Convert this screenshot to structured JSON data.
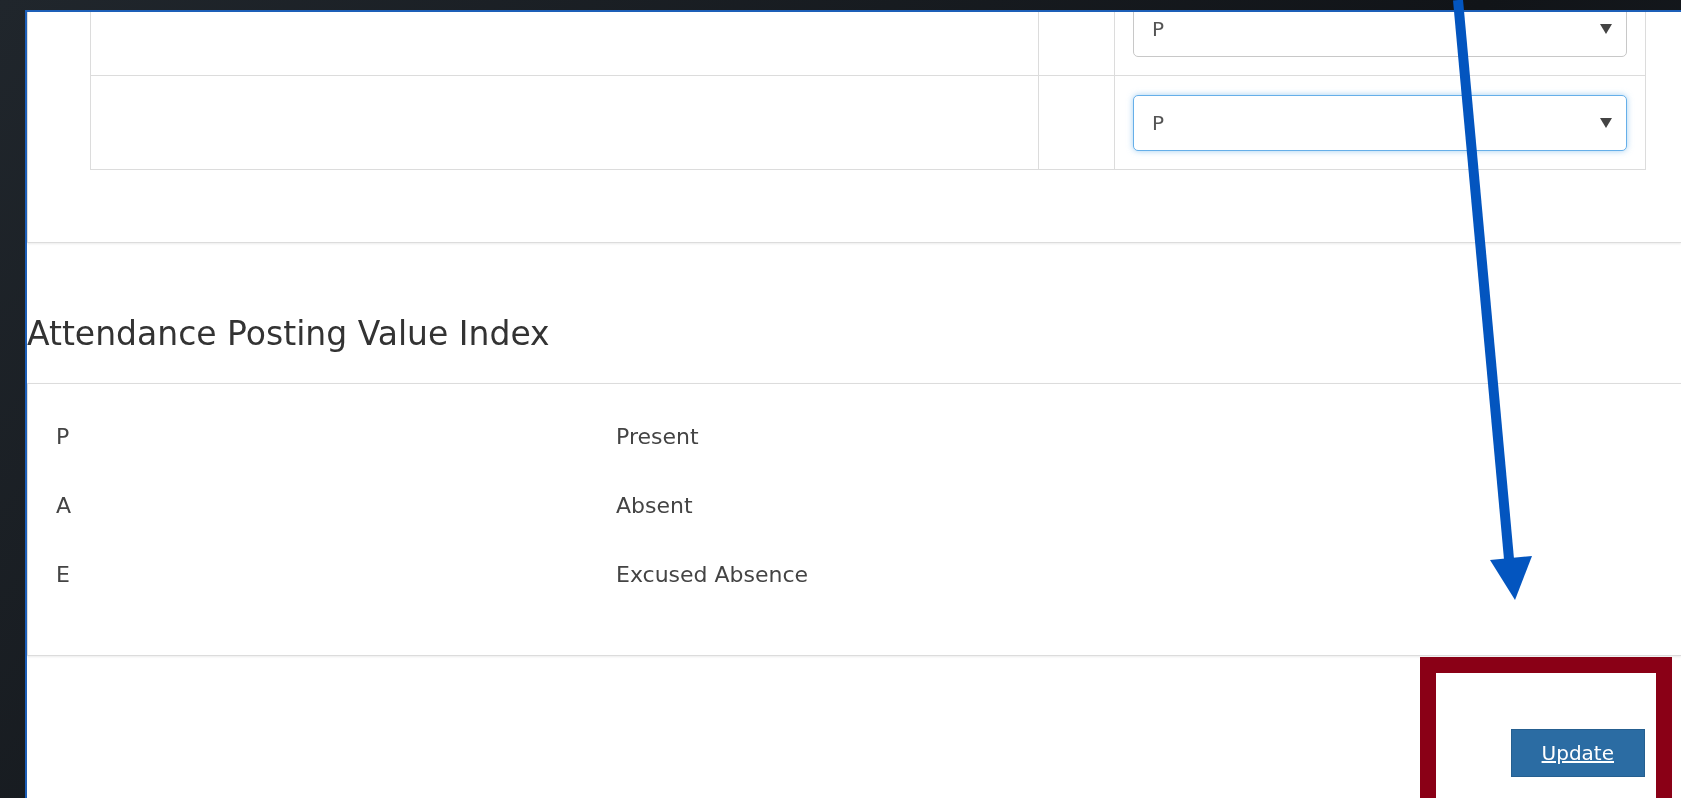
{
  "attendance_table": {
    "rows": [
      {
        "status_select": {
          "value": "P",
          "focused": false
        }
      },
      {
        "status_select": {
          "value": "P",
          "focused": true
        }
      }
    ]
  },
  "value_index": {
    "title": "Attendance Posting Value Index",
    "entries": [
      {
        "code": "P",
        "meaning": "Present"
      },
      {
        "code": "A",
        "meaning": "Absent"
      },
      {
        "code": "E",
        "meaning": "Excused Absence"
      }
    ]
  },
  "update_button": {
    "label": "Update"
  },
  "annotations": {
    "arrow": true,
    "highlight_box": true
  }
}
